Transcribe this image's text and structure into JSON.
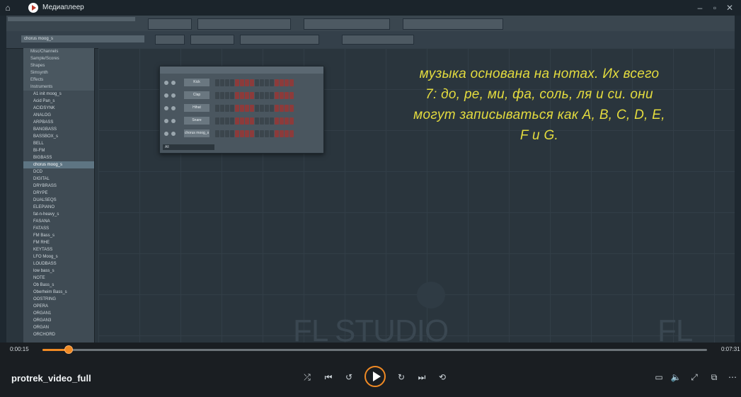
{
  "player": {
    "app_title": "Медиаплеер",
    "video_title": "protrek_video_full",
    "time_current": "0:00:15",
    "time_total": "0:07:31",
    "progress": 0.04,
    "accent": "#f08a24"
  },
  "fl": {
    "selector_text": "chorus moog_s",
    "watermark": "FL STUDIO",
    "watermark_right": "FL STU",
    "browser_items": [
      {
        "label": "Misc/Channels",
        "kind": "folder"
      },
      {
        "label": "Sample/Scores",
        "kind": "folder"
      },
      {
        "label": "Shapes",
        "kind": "folder"
      },
      {
        "label": "Simsynth",
        "kind": "folder"
      },
      {
        "label": "Effects",
        "kind": "folder"
      },
      {
        "label": "Instruments",
        "kind": "folder"
      },
      {
        "label": "A1 init moog_s",
        "kind": "file"
      },
      {
        "label": "Acid Pan_s",
        "kind": "file"
      },
      {
        "label": "ACIDSYNK",
        "kind": "file"
      },
      {
        "label": "ANALOG",
        "kind": "file"
      },
      {
        "label": "ARPBASS",
        "kind": "file"
      },
      {
        "label": "BANGBASS",
        "kind": "file"
      },
      {
        "label": "BASSBOX_s",
        "kind": "file"
      },
      {
        "label": "BELL",
        "kind": "file"
      },
      {
        "label": "BI-FM",
        "kind": "file"
      },
      {
        "label": "BIGBASS",
        "kind": "file"
      },
      {
        "label": "chorus moog_s",
        "kind": "selected"
      },
      {
        "label": "DCD",
        "kind": "file"
      },
      {
        "label": "DIGITAL",
        "kind": "file"
      },
      {
        "label": "DRYBRASS",
        "kind": "file"
      },
      {
        "label": "DRYPE",
        "kind": "file"
      },
      {
        "label": "DUALSEQS",
        "kind": "file"
      },
      {
        "label": "ELEPIANO",
        "kind": "file"
      },
      {
        "label": "fat-n-heavy_s",
        "kind": "file"
      },
      {
        "label": "FASANA",
        "kind": "file"
      },
      {
        "label": "FATASS",
        "kind": "file"
      },
      {
        "label": "FM Bass_s",
        "kind": "file"
      },
      {
        "label": "FM RHE",
        "kind": "file"
      },
      {
        "label": "KEYTASS",
        "kind": "file"
      },
      {
        "label": "LFO Moog_s",
        "kind": "file"
      },
      {
        "label": "LOUDBASS",
        "kind": "file"
      },
      {
        "label": "low bass_s",
        "kind": "file"
      },
      {
        "label": "NOTE",
        "kind": "file"
      },
      {
        "label": "Ob Bass_s",
        "kind": "file"
      },
      {
        "label": "Oberheim Bass_s",
        "kind": "file"
      },
      {
        "label": "OOSTRING",
        "kind": "file"
      },
      {
        "label": "OPERA",
        "kind": "file"
      },
      {
        "label": "ORGAN1",
        "kind": "file"
      },
      {
        "label": "ORGAN3",
        "kind": "file"
      },
      {
        "label": "ORGAN",
        "kind": "file"
      },
      {
        "label": "ORCHORD",
        "kind": "file"
      }
    ],
    "rack": {
      "channels": [
        "Kick",
        "Clap",
        "Hihat",
        "Snare",
        "chorus moog_s"
      ],
      "footer": "All"
    }
  },
  "subtitle": {
    "lines": [
      "музыка основана на нотах. Их всего",
      "7: до, ре, ми, фа, соль, ля и си. они",
      "могут записываться как A, B, C, D, E,",
      "F и G."
    ],
    "color": "#e4dc3e"
  },
  "icons": {
    "home": "home-icon",
    "shuffle": "shuffle-icon",
    "previous": "previous-icon",
    "rewind": "rewind-10-icon",
    "play": "play-icon",
    "forward": "forward-30-icon",
    "next": "next-icon",
    "repeat": "repeat-icon",
    "subtitles": "subtitles-icon",
    "volume": "volume-icon",
    "fullscreen": "fullscreen-icon",
    "miniplayer": "miniplayer-icon",
    "more": "more-icon"
  }
}
